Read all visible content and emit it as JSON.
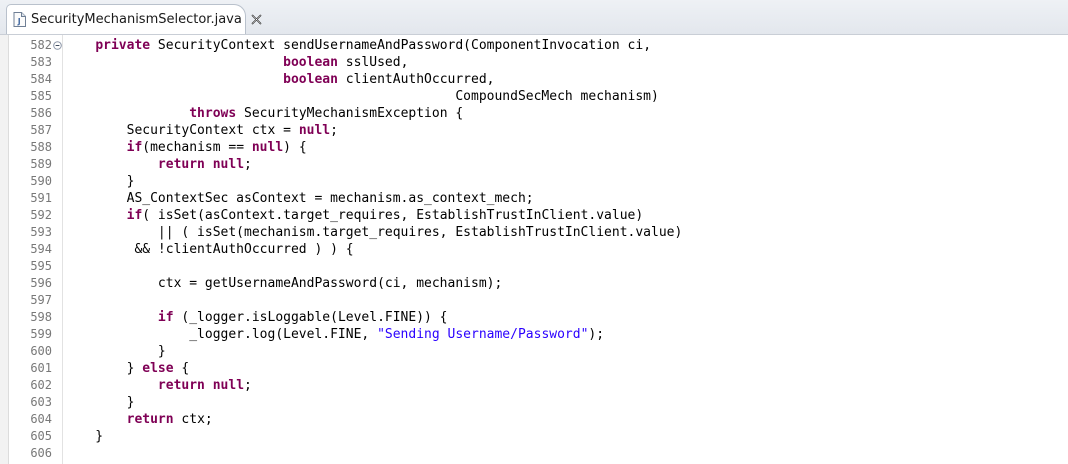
{
  "tab": {
    "title": "SecurityMechanismSelector.java",
    "icon": "java-file-icon",
    "close_icon": "close-icon"
  },
  "colors": {
    "keyword": "#7f0055",
    "string": "#2a00ff",
    "line_number": "#787878"
  },
  "lines": [
    {
      "num": "582",
      "fold": true,
      "tokens": [
        {
          "t": "    "
        },
        {
          "t": "private",
          "k": true
        },
        {
          "t": " SecurityContext sendUsernameAndPassword(ComponentInvocation ci,"
        }
      ]
    },
    {
      "num": "583",
      "tokens": [
        {
          "t": "                            "
        },
        {
          "t": "boolean",
          "k": true
        },
        {
          "t": " sslUsed,"
        }
      ]
    },
    {
      "num": "584",
      "tokens": [
        {
          "t": "                            "
        },
        {
          "t": "boolean",
          "k": true
        },
        {
          "t": " clientAuthOccurred,"
        }
      ]
    },
    {
      "num": "585",
      "tokens": [
        {
          "t": "                                                  CompoundSecMech mechanism)"
        }
      ]
    },
    {
      "num": "586",
      "tokens": [
        {
          "t": "                "
        },
        {
          "t": "throws",
          "k": true
        },
        {
          "t": " SecurityMechanismException {"
        }
      ]
    },
    {
      "num": "587",
      "tokens": [
        {
          "t": "        SecurityContext ctx = "
        },
        {
          "t": "null",
          "k": true
        },
        {
          "t": ";"
        }
      ]
    },
    {
      "num": "588",
      "tokens": [
        {
          "t": "        "
        },
        {
          "t": "if",
          "k": true
        },
        {
          "t": "(mechanism == "
        },
        {
          "t": "null",
          "k": true
        },
        {
          "t": ") {"
        }
      ]
    },
    {
      "num": "589",
      "tokens": [
        {
          "t": "            "
        },
        {
          "t": "return",
          "k": true
        },
        {
          "t": " "
        },
        {
          "t": "null",
          "k": true
        },
        {
          "t": ";"
        }
      ]
    },
    {
      "num": "590",
      "tokens": [
        {
          "t": "        }"
        }
      ]
    },
    {
      "num": "591",
      "tokens": [
        {
          "t": "        AS_ContextSec asContext = mechanism.as_context_mech;"
        }
      ]
    },
    {
      "num": "592",
      "tokens": [
        {
          "t": "        "
        },
        {
          "t": "if",
          "k": true
        },
        {
          "t": "( isSet(asContext.target_requires, EstablishTrustInClient.value)"
        }
      ]
    },
    {
      "num": "593",
      "tokens": [
        {
          "t": "            || ( isSet(mechanism.target_requires, EstablishTrustInClient.value)"
        }
      ]
    },
    {
      "num": "594",
      "tokens": [
        {
          "t": "         && !clientAuthOccurred ) ) {"
        }
      ]
    },
    {
      "num": "595",
      "tokens": []
    },
    {
      "num": "596",
      "tokens": [
        {
          "t": "            ctx = getUsernameAndPassword(ci, mechanism);"
        }
      ]
    },
    {
      "num": "597",
      "tokens": []
    },
    {
      "num": "598",
      "tokens": [
        {
          "t": "            "
        },
        {
          "t": "if",
          "k": true
        },
        {
          "t": " (_logger.isLoggable(Level.FINE)) {"
        }
      ]
    },
    {
      "num": "599",
      "tokens": [
        {
          "t": "                _logger.log(Level.FINE, "
        },
        {
          "t": "\"Sending Username/Password\"",
          "s": true
        },
        {
          "t": ");"
        }
      ]
    },
    {
      "num": "600",
      "tokens": [
        {
          "t": "            }"
        }
      ]
    },
    {
      "num": "601",
      "tokens": [
        {
          "t": "        } "
        },
        {
          "t": "else",
          "k": true
        },
        {
          "t": " {"
        }
      ]
    },
    {
      "num": "602",
      "tokens": [
        {
          "t": "            "
        },
        {
          "t": "return",
          "k": true
        },
        {
          "t": " "
        },
        {
          "t": "null",
          "k": true
        },
        {
          "t": ";"
        }
      ]
    },
    {
      "num": "603",
      "tokens": [
        {
          "t": "        }"
        }
      ]
    },
    {
      "num": "604",
      "tokens": [
        {
          "t": "        "
        },
        {
          "t": "return",
          "k": true
        },
        {
          "t": " ctx;"
        }
      ]
    },
    {
      "num": "605",
      "tokens": [
        {
          "t": "    }"
        }
      ]
    },
    {
      "num": "606",
      "tokens": []
    }
  ]
}
